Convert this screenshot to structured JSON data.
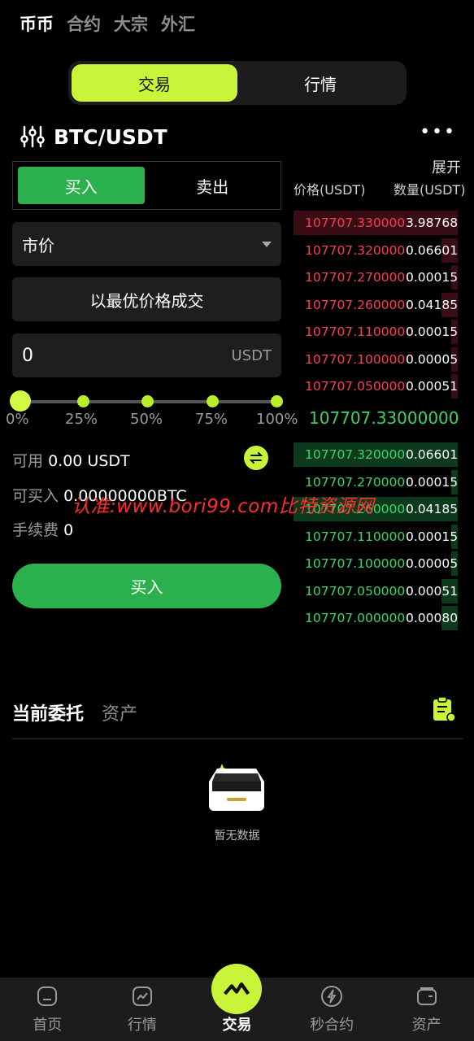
{
  "top_tabs": [
    "币币",
    "合约",
    "大宗",
    "外汇"
  ],
  "segment": {
    "trade": "交易",
    "market": "行情"
  },
  "pair": "BTC/USDT",
  "more": "•••",
  "expand_label": "展开",
  "side": {
    "buy": "买入",
    "sell": "卖出"
  },
  "order_type": "市价",
  "best_price_label": "以最优价格成交",
  "amount": {
    "value": "0",
    "unit": "USDT"
  },
  "slider": {
    "value_percent": 0,
    "labels": [
      "0%",
      "25%",
      "50%",
      "75%",
      "100%"
    ]
  },
  "info": {
    "available_label": "可用",
    "available_value": "0.00 USDT",
    "max_buy_label": "可买入",
    "max_buy_value": "0.00000000BTC",
    "fee_label": "手续费",
    "fee_value": "0"
  },
  "buy_button": "买入",
  "orderbook": {
    "price_header": "价格(USDT)",
    "qty_header": "数量(USDT)",
    "asks": [
      {
        "price": "107707.330000",
        "qty": "3.98768",
        "depth": 1.0
      },
      {
        "price": "107707.320000",
        "qty": "0.06601",
        "depth": 0.1
      },
      {
        "price": "107707.270000",
        "qty": "0.00015",
        "depth": 0.01
      },
      {
        "price": "107707.260000",
        "qty": "0.04185",
        "depth": 0.1
      },
      {
        "price": "107707.110000",
        "qty": "0.00015",
        "depth": 0.01
      },
      {
        "price": "107707.100000",
        "qty": "0.00005",
        "depth": 0.01
      },
      {
        "price": "107707.050000",
        "qty": "0.00051",
        "depth": 0.01
      }
    ],
    "mid_price": "107707.33000000",
    "bids": [
      {
        "price": "107707.320000",
        "qty": "0.06601",
        "depth": 1.0
      },
      {
        "price": "107707.270000",
        "qty": "0.00015",
        "depth": 0.01
      },
      {
        "price": "107707.260000",
        "qty": "0.04185",
        "depth": 1.0
      },
      {
        "price": "107707.110000",
        "qty": "0.00015",
        "depth": 0.01
      },
      {
        "price": "107707.100000",
        "qty": "0.00005",
        "depth": 0.01
      },
      {
        "price": "107707.050000",
        "qty": "0.00051",
        "depth": 0.1
      },
      {
        "price": "107707.000000",
        "qty": "0.00080",
        "depth": 0.1
      }
    ]
  },
  "watermark": "认准:www.bori99.com比特资源网",
  "orders": {
    "tab_current": "当前委托",
    "tab_assets": "资产",
    "empty_text": "暂无数据"
  },
  "bottom_nav": [
    "首页",
    "行情",
    "交易",
    "秒合约",
    "资产"
  ],
  "colors": {
    "accent": "#c8f53a",
    "buy": "#2bb04e",
    "ask_price": "#f0405a",
    "bid_price": "#3dd36a"
  }
}
